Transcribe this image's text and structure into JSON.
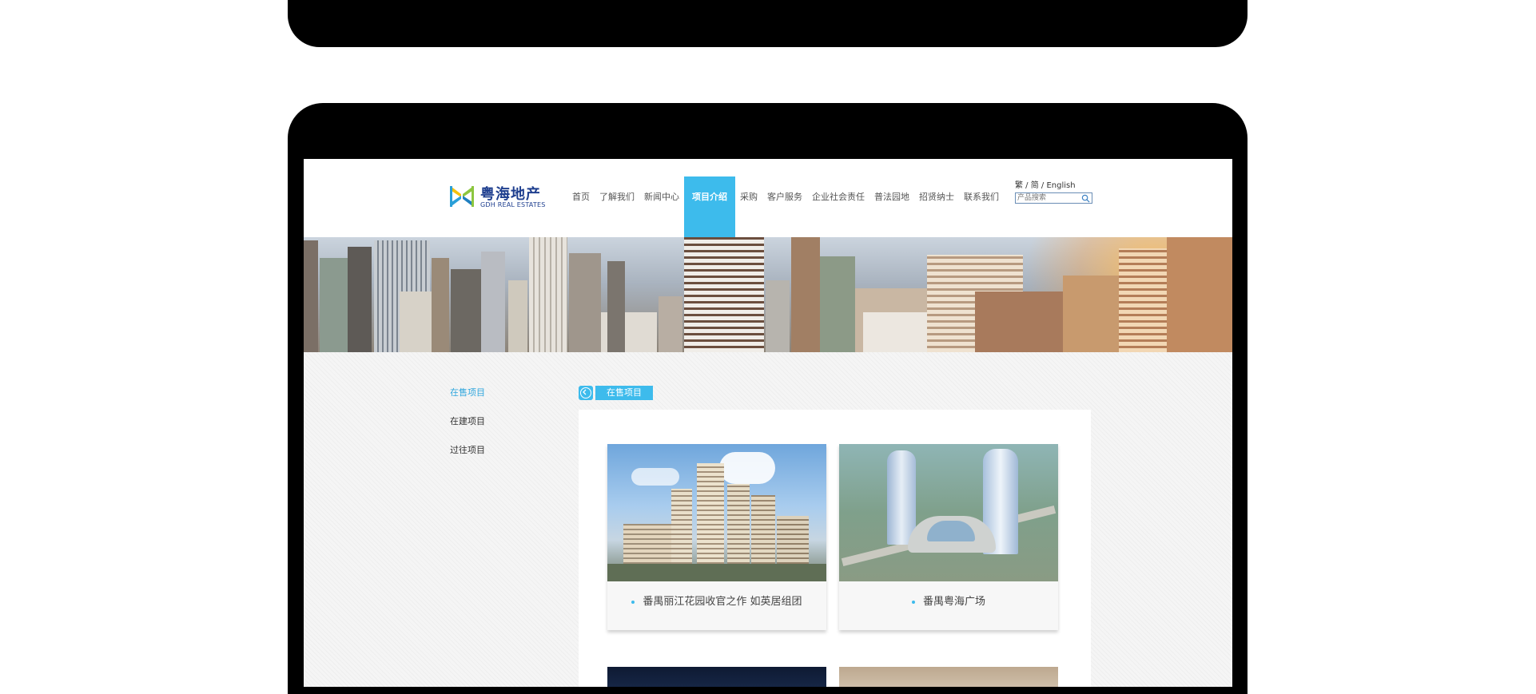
{
  "logo": {
    "cn": "粤海地产",
    "en": "GDH REAL ESTATES"
  },
  "nav": [
    {
      "label": "首页",
      "active": false
    },
    {
      "label": "了解我们",
      "active": false
    },
    {
      "label": "新闻中心",
      "active": false
    },
    {
      "label": "项目介绍",
      "active": true
    },
    {
      "label": "采购",
      "active": false
    },
    {
      "label": "客户服务",
      "active": false
    },
    {
      "label": "企业社会责任",
      "active": false
    },
    {
      "label": "普法园地",
      "active": false
    },
    {
      "label": "招贤纳士",
      "active": false
    },
    {
      "label": "联系我们",
      "active": false
    }
  ],
  "lang": {
    "label": "繁 / 简 / English"
  },
  "search": {
    "placeholder": "产品搜索"
  },
  "sidebar": {
    "items": [
      {
        "label": "在售项目",
        "active": true
      },
      {
        "label": "在建项目",
        "active": false
      },
      {
        "label": "过往项目",
        "active": false
      }
    ]
  },
  "crumb": {
    "label": "在售项目"
  },
  "projects": [
    {
      "title": "番禺丽江花园收官之作 如英居组团"
    },
    {
      "title": "番禺粤海广场"
    }
  ],
  "colors": {
    "accent": "#3dbbec",
    "brand": "#1f3f8f"
  }
}
